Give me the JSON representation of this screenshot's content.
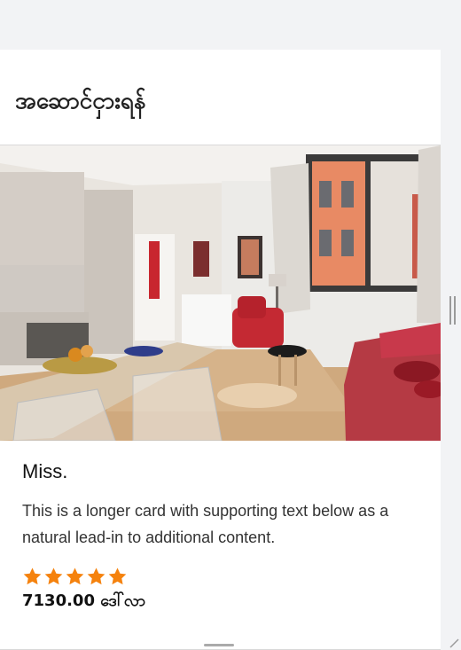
{
  "page": {
    "title": "အဆောင်ငှားရန်"
  },
  "card": {
    "title": "Miss.",
    "text": "This is a longer card with supporting text below as a natural lead-in to additional content.",
    "rating": 5,
    "rating_max": 5,
    "price": "7130.00 ဒေါ်လာ",
    "image": "apartment-living-room-photo",
    "star_color": "#f5820d"
  }
}
